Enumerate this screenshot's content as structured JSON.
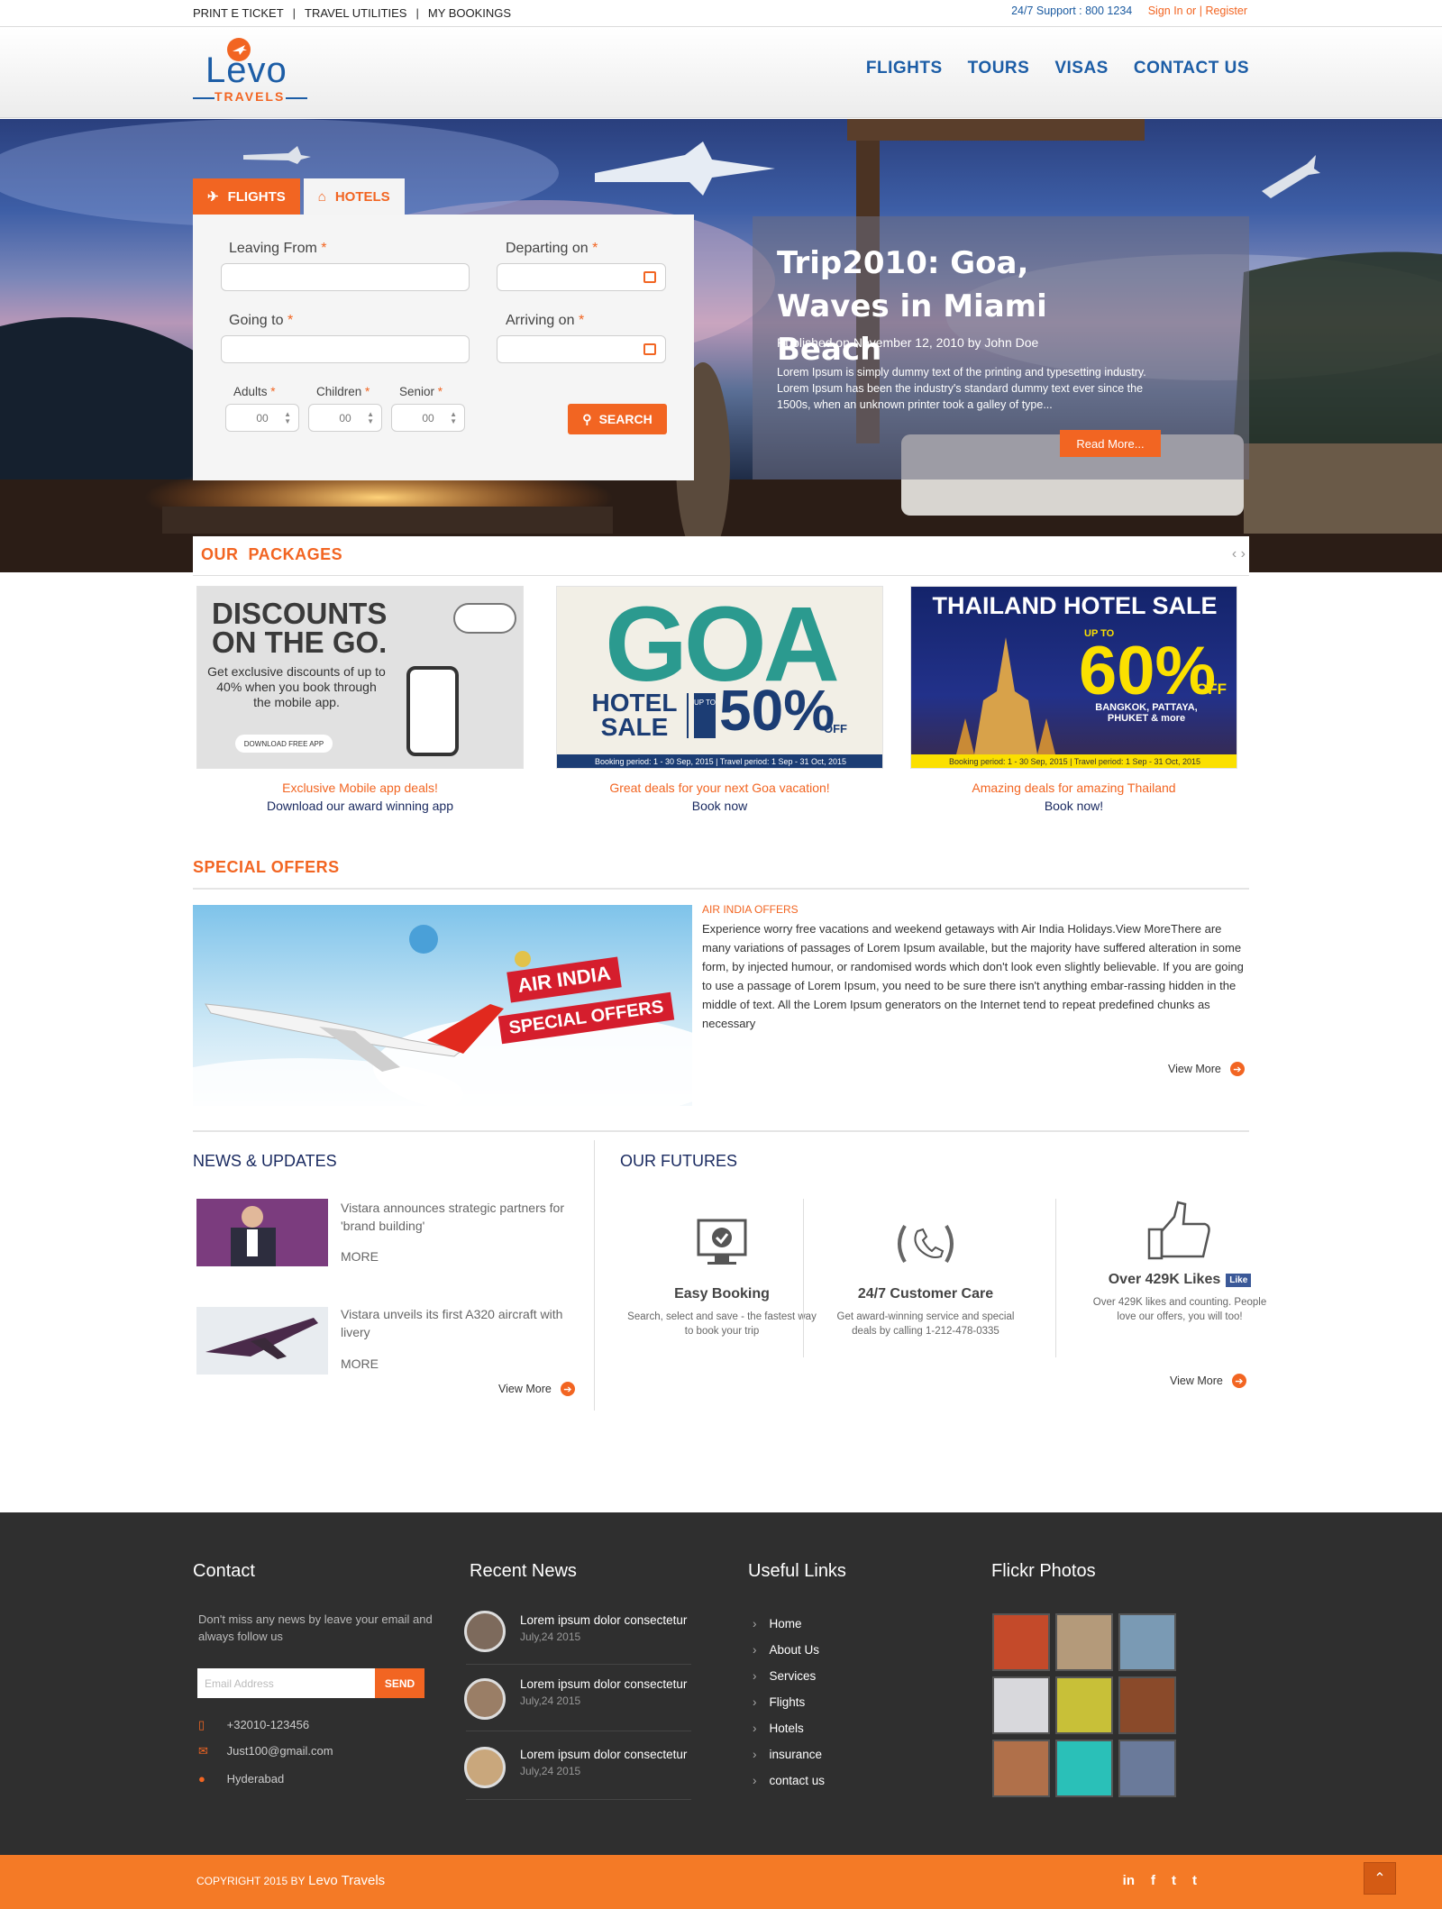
{
  "topbar": {
    "links": [
      "PRINT E TICKET",
      "TRAVEL UTILITIES",
      "MY BOOKINGS"
    ],
    "support": "24/7 Support : 800 1234",
    "signin": "Sign In or",
    "register": "Register"
  },
  "logo": {
    "name": "Levo",
    "sub": "TRAVELS"
  },
  "nav": [
    "FLIGHTS",
    "TOURS",
    "VISAS",
    "CONTACT US"
  ],
  "search": {
    "tab_flights": "FLIGHTS",
    "tab_hotels": "HOTELS",
    "leaving_from": "Leaving From",
    "departing_on": "Departing on",
    "going_to": "Going to",
    "arriving_on": "Arriving on",
    "adults": "Adults",
    "children": "Children",
    "senior": "Senior",
    "adults_value": "00",
    "children_value": "00",
    "senior_value": "00",
    "required": "*",
    "button": "SEARCH"
  },
  "promo": {
    "title": "Trip2010: Goa, Waves in Miami Beach",
    "meta": "Published on November 12, 2010 by John Doe",
    "text": "Lorem Ipsum is simply dummy text of the printing and typesetting industry. Lorem Ipsum has been the industry's standard dummy text ever since the 1500s, when an unknown printer took a galley of type...",
    "button": "Read More..."
  },
  "packages": {
    "title": "OUR  PACKAGES",
    "arrows": "‹ ›",
    "items": [
      {
        "banner_title": "DISCOUNTS ON THE GO.",
        "banner_text": "Get exclusive discounts of up to 40% when you book through the mobile app.",
        "banner_button": "DOWNLOAD FREE APP",
        "caption": "Exclusive Mobile app deals!",
        "link": "Download our award winning app"
      },
      {
        "banner_title": "GOA",
        "banner_sub": "HOTEL SALE",
        "banner_upto": "UP TO",
        "banner_pct": "50%",
        "banner_off": "OFF",
        "banner_period": "Booking period: 1 - 30 Sep, 2015 | Travel period: 1 Sep - 31 Oct, 2015",
        "caption": "Great deals for your next Goa vacation!",
        "link": "Book now"
      },
      {
        "banner_title": "THAILAND HOTEL SALE",
        "banner_upto": "UP TO",
        "banner_pct": "60%",
        "banner_off": "OFF",
        "banner_places": "BANGKOK, PATTAYA, PHUKET & more",
        "banner_period": "Booking period: 1 - 30 Sep, 2015 | Travel period: 1 Sep - 31 Oct, 2015",
        "caption": "Amazing deals for amazing Thailand",
        "link": "Book now!"
      }
    ]
  },
  "special": {
    "title": "SPECIAL OFFERS",
    "img_line1": "AIR INDIA",
    "img_line2": "SPECIAL OFFERS",
    "subtitle": "AIR INDIA OFFERS",
    "text": "Experience worry free vacations and weekend getaways with Air India Holidays.View MoreThere are many variations of passages of Lorem Ipsum available, but the majority have suffered alteration in some form, by injected humour, or randomised words which don't look even slightly believable. If you are going to use a passage of Lorem Ipsum, you need to be sure there isn't anything embar-rassing hidden in the middle of text. All the Lorem Ipsum generators on the Internet tend to repeat predefined chunks as necessary",
    "view_more": "View More"
  },
  "news": {
    "title": "NEWS & UPDATES",
    "items": [
      {
        "text": "Vistara announces strategic partners for 'brand building'",
        "more": "MORE"
      },
      {
        "text": "Vistara unveils its first A320 aircraft with livery",
        "more": "MORE"
      }
    ],
    "view_more": "View More"
  },
  "futures": {
    "title": "OUR FUTURES",
    "items": [
      {
        "title": "Easy Booking",
        "text": "Search, select and save - the fastest way to book your trip",
        "icon": "monitor-check-icon"
      },
      {
        "title": "24/7 Customer Care",
        "text": "Get award-winning service and special deals by calling 1-212-478-0335",
        "icon": "phone-laurel-icon"
      },
      {
        "title": "Over 429K Likes",
        "badge": "Like",
        "text": "Over 429K likes and counting. People love our offers, you will too!",
        "icon": "thumbs-up-icon"
      }
    ],
    "view_more": "View More"
  },
  "footer": {
    "contact": {
      "title": "Contact",
      "text": "Don't miss any news by leave your email and always follow us",
      "email_placeholder": "Email Address",
      "send": "SEND",
      "phone": "+32010-123456",
      "email": "Just100@gmail.com",
      "location": "Hyderabad"
    },
    "recent": {
      "title": "Recent News",
      "items": [
        {
          "title": "Lorem ipsum dolor consectetur",
          "date": "July,24 2015"
        },
        {
          "title": "Lorem ipsum dolor consectetur",
          "date": "July,24 2015"
        },
        {
          "title": "Lorem ipsum dolor consectetur",
          "date": "July,24 2015"
        }
      ]
    },
    "links": {
      "title": "Useful Links",
      "items": [
        "Home",
        "About Us",
        "Services",
        "Flights",
        "Hotels",
        "insurance",
        "contact us"
      ]
    },
    "flickr": {
      "title": "Flickr Photos"
    }
  },
  "copyright": {
    "prefix": "COPYRIGHT 2015 BY",
    "brand": "Levo Travels"
  },
  "social": [
    "in",
    "f",
    "t",
    "t"
  ],
  "colors": {
    "accent": "#f26522",
    "brand": "#1c5da6",
    "footer": "#2f2f2f"
  }
}
